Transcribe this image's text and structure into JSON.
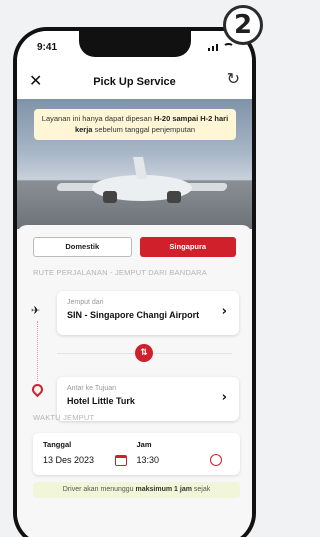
{
  "step_number": "2",
  "status_bar": {
    "time": "9:41"
  },
  "header": {
    "title": "Pick Up Service",
    "close_icon": "close-icon",
    "refresh_icon": "refresh-icon"
  },
  "notice": {
    "prefix": "Layanan ini hanya dapat dipesan",
    "highlight": "H-20 sampai H-2 hari kerja",
    "suffix": "sebelum tanggal penjemputan"
  },
  "tabs": {
    "domestic": "Domestik",
    "singapore": "Singapura",
    "active": "Singapura"
  },
  "route": {
    "section_label": "RUTE PERJALANAN - JEMPUT DARI BANDARA",
    "from_label": "Jemput dari",
    "from_value": "SIN - Singapore Changi Airport",
    "to_label": "Antar ke Tujuan",
    "to_value": "Hotel Little Turk"
  },
  "pickup_time": {
    "section_label": "WAKTU JEMPUT",
    "date_label": "Tanggal",
    "date_value": "13 Des 2023",
    "time_label": "Jam",
    "time_value": "13:30"
  },
  "info": {
    "prefix": "Driver akan menunggu",
    "highlight": "maksimum 1 jam",
    "suffix": "sejak"
  },
  "colors": {
    "accent": "#d0202c",
    "notice_bg": "#fff6d6"
  }
}
